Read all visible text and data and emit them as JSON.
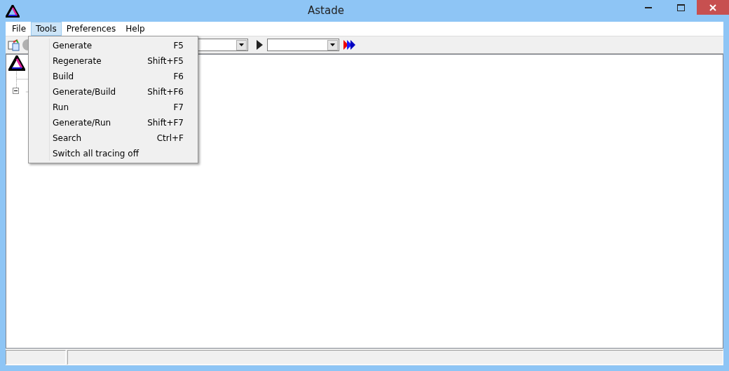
{
  "window": {
    "title": "Astade"
  },
  "menu": [
    {
      "label": "File",
      "selected": false
    },
    {
      "label": "Tools",
      "selected": true
    },
    {
      "label": "Preferences",
      "selected": false
    },
    {
      "label": "Help",
      "selected": false
    }
  ],
  "dropdown": [
    {
      "label": "Generate",
      "shortcut": "F5"
    },
    {
      "label": "Regenerate",
      "shortcut": "Shift+F5"
    },
    {
      "label": "Build",
      "shortcut": "F6"
    },
    {
      "label": "Generate/Build",
      "shortcut": "Shift+F6"
    },
    {
      "label": "Run",
      "shortcut": "F7"
    },
    {
      "label": "Generate/Run",
      "shortcut": "Shift+F7"
    },
    {
      "label": "Search",
      "shortcut": "Ctrl+F"
    },
    {
      "label": "Switch all tracing off"
    }
  ],
  "tree": {
    "expanded": true
  }
}
